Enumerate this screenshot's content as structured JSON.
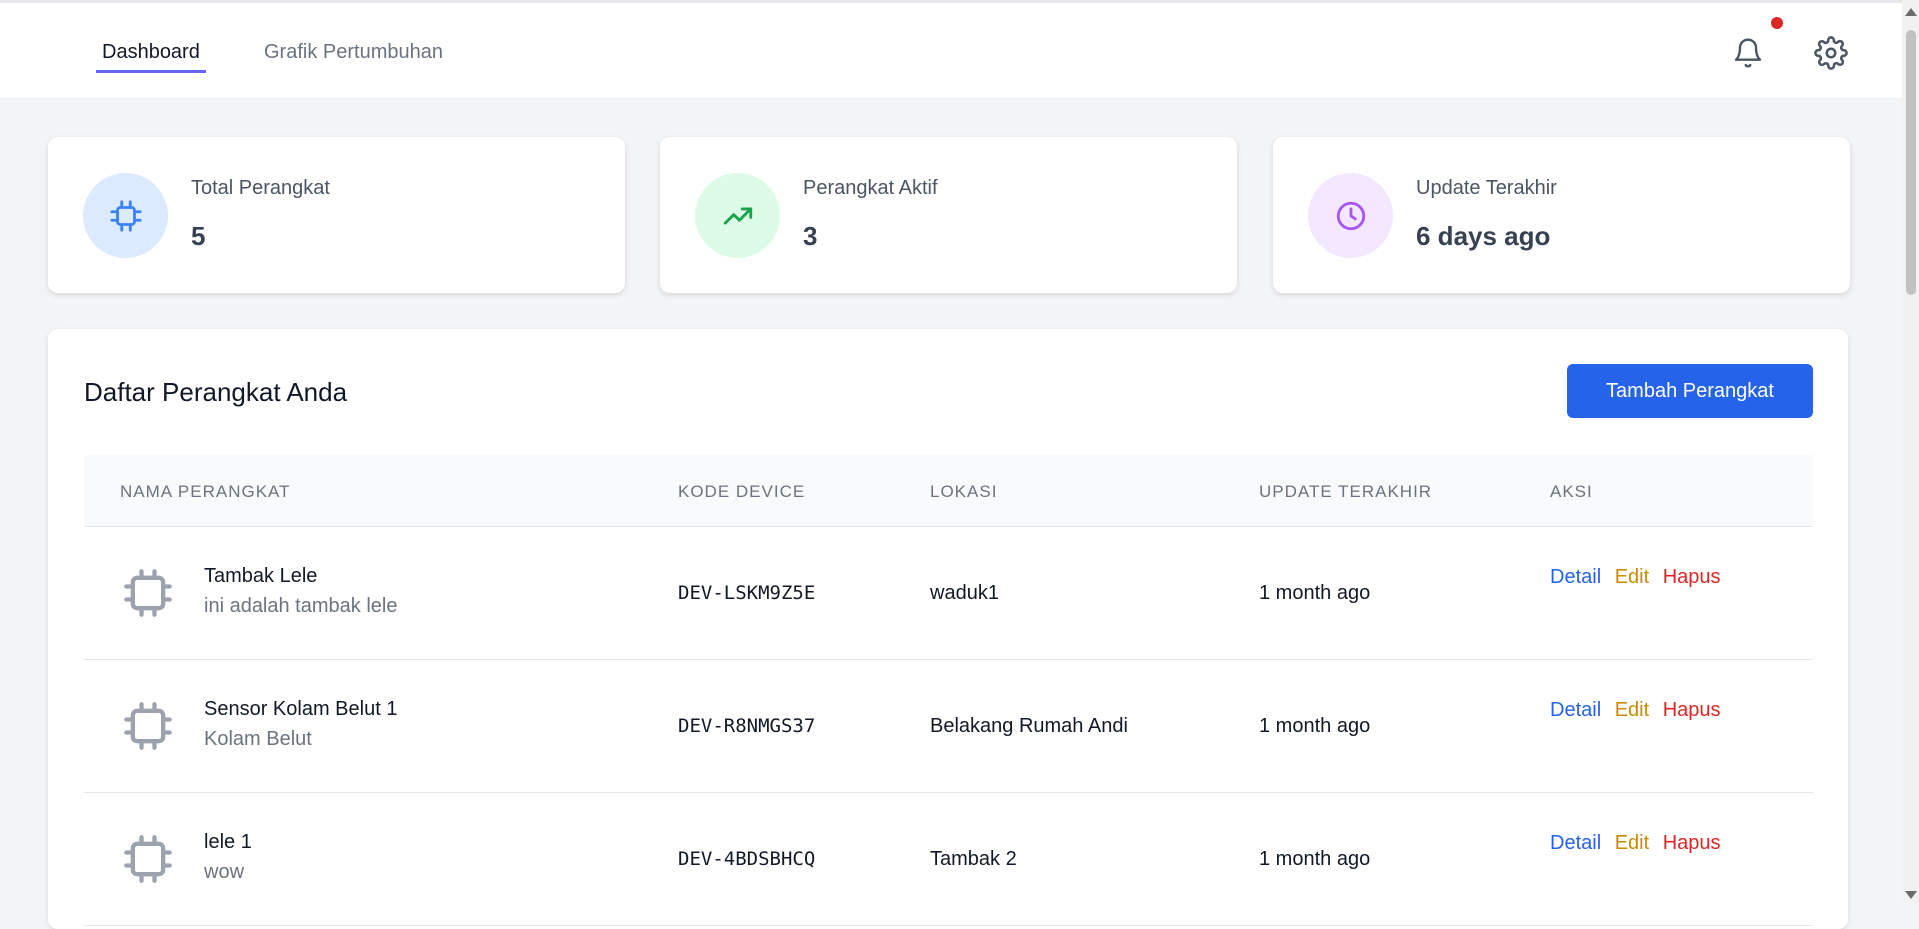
{
  "nav": {
    "tabs": [
      {
        "label": "Dashboard",
        "active": true
      },
      {
        "label": "Grafik Pertumbuhan",
        "active": false
      }
    ],
    "icons": {
      "notifications": "bell-icon",
      "settings": "gear-icon"
    },
    "has_notification": true
  },
  "stats": [
    {
      "label": "Total Perangkat",
      "value": "5",
      "icon": "chip-icon",
      "icon_color": "#3b82f6",
      "bg": "#dbeafe"
    },
    {
      "label": "Perangkat Aktif",
      "value": "3",
      "icon": "trending-up-icon",
      "icon_color": "#16a34a",
      "bg": "#dcfce7"
    },
    {
      "label": "Update Terakhir",
      "value": "6 days ago",
      "icon": "clock-icon",
      "icon_color": "#a855f7",
      "bg": "#f3e8ff"
    }
  ],
  "devices": {
    "title": "Daftar Perangkat Anda",
    "add_button": "Tambah Perangkat",
    "columns": [
      "NAMA PERANGKAT",
      "KODE DEVICE",
      "LOKASI",
      "UPDATE TERAKHIR",
      "AKSI"
    ],
    "actions": {
      "detail": "Detail",
      "edit": "Edit",
      "delete": "Hapus"
    },
    "rows": [
      {
        "name": "Tambak Lele",
        "description": "ini adalah tambak lele",
        "code": "DEV-LSKM9Z5E",
        "location": "waduk1",
        "updated": "1 month ago"
      },
      {
        "name": "Sensor Kolam Belut 1",
        "description": "Kolam Belut",
        "code": "DEV-R8NMGS37",
        "location": "Belakang Rumah Andi",
        "updated": "1 month ago"
      },
      {
        "name": "lele 1",
        "description": "wow",
        "code": "DEV-4BDSBHCQ",
        "location": "Tambak 2",
        "updated": "1 month ago"
      }
    ]
  },
  "colors": {
    "primary": "#2563eb",
    "edit": "#ca8a04",
    "delete": "#dc2626",
    "active_tab_underline": "#6366f1"
  }
}
